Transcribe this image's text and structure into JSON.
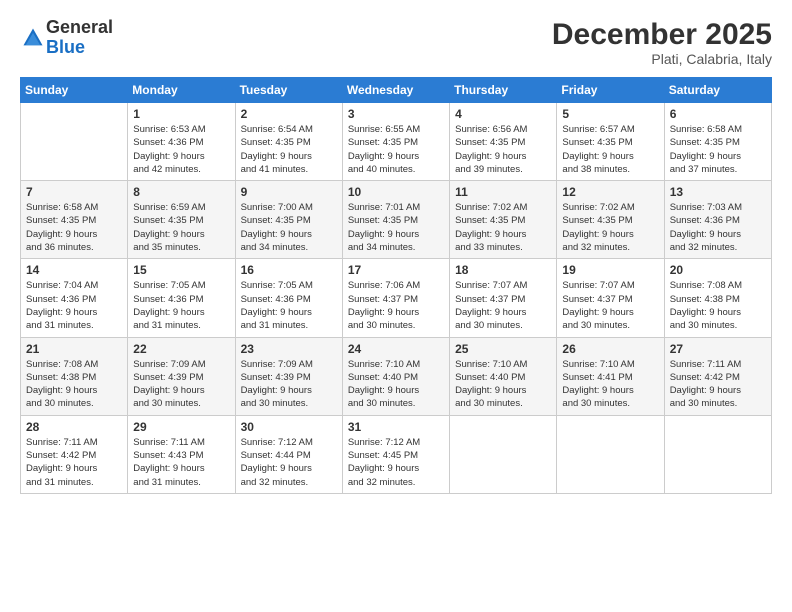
{
  "logo": {
    "general": "General",
    "blue": "Blue"
  },
  "header": {
    "month": "December 2025",
    "location": "Plati, Calabria, Italy"
  },
  "weekdays": [
    "Sunday",
    "Monday",
    "Tuesday",
    "Wednesday",
    "Thursday",
    "Friday",
    "Saturday"
  ],
  "weeks": [
    [
      {
        "day": "",
        "info": ""
      },
      {
        "day": "1",
        "info": "Sunrise: 6:53 AM\nSunset: 4:36 PM\nDaylight: 9 hours\nand 42 minutes."
      },
      {
        "day": "2",
        "info": "Sunrise: 6:54 AM\nSunset: 4:35 PM\nDaylight: 9 hours\nand 41 minutes."
      },
      {
        "day": "3",
        "info": "Sunrise: 6:55 AM\nSunset: 4:35 PM\nDaylight: 9 hours\nand 40 minutes."
      },
      {
        "day": "4",
        "info": "Sunrise: 6:56 AM\nSunset: 4:35 PM\nDaylight: 9 hours\nand 39 minutes."
      },
      {
        "day": "5",
        "info": "Sunrise: 6:57 AM\nSunset: 4:35 PM\nDaylight: 9 hours\nand 38 minutes."
      },
      {
        "day": "6",
        "info": "Sunrise: 6:58 AM\nSunset: 4:35 PM\nDaylight: 9 hours\nand 37 minutes."
      }
    ],
    [
      {
        "day": "7",
        "info": "Sunrise: 6:58 AM\nSunset: 4:35 PM\nDaylight: 9 hours\nand 36 minutes."
      },
      {
        "day": "8",
        "info": "Sunrise: 6:59 AM\nSunset: 4:35 PM\nDaylight: 9 hours\nand 35 minutes."
      },
      {
        "day": "9",
        "info": "Sunrise: 7:00 AM\nSunset: 4:35 PM\nDaylight: 9 hours\nand 34 minutes."
      },
      {
        "day": "10",
        "info": "Sunrise: 7:01 AM\nSunset: 4:35 PM\nDaylight: 9 hours\nand 34 minutes."
      },
      {
        "day": "11",
        "info": "Sunrise: 7:02 AM\nSunset: 4:35 PM\nDaylight: 9 hours\nand 33 minutes."
      },
      {
        "day": "12",
        "info": "Sunrise: 7:02 AM\nSunset: 4:35 PM\nDaylight: 9 hours\nand 32 minutes."
      },
      {
        "day": "13",
        "info": "Sunrise: 7:03 AM\nSunset: 4:36 PM\nDaylight: 9 hours\nand 32 minutes."
      }
    ],
    [
      {
        "day": "14",
        "info": "Sunrise: 7:04 AM\nSunset: 4:36 PM\nDaylight: 9 hours\nand 31 minutes."
      },
      {
        "day": "15",
        "info": "Sunrise: 7:05 AM\nSunset: 4:36 PM\nDaylight: 9 hours\nand 31 minutes."
      },
      {
        "day": "16",
        "info": "Sunrise: 7:05 AM\nSunset: 4:36 PM\nDaylight: 9 hours\nand 31 minutes."
      },
      {
        "day": "17",
        "info": "Sunrise: 7:06 AM\nSunset: 4:37 PM\nDaylight: 9 hours\nand 30 minutes."
      },
      {
        "day": "18",
        "info": "Sunrise: 7:07 AM\nSunset: 4:37 PM\nDaylight: 9 hours\nand 30 minutes."
      },
      {
        "day": "19",
        "info": "Sunrise: 7:07 AM\nSunset: 4:37 PM\nDaylight: 9 hours\nand 30 minutes."
      },
      {
        "day": "20",
        "info": "Sunrise: 7:08 AM\nSunset: 4:38 PM\nDaylight: 9 hours\nand 30 minutes."
      }
    ],
    [
      {
        "day": "21",
        "info": "Sunrise: 7:08 AM\nSunset: 4:38 PM\nDaylight: 9 hours\nand 30 minutes."
      },
      {
        "day": "22",
        "info": "Sunrise: 7:09 AM\nSunset: 4:39 PM\nDaylight: 9 hours\nand 30 minutes."
      },
      {
        "day": "23",
        "info": "Sunrise: 7:09 AM\nSunset: 4:39 PM\nDaylight: 9 hours\nand 30 minutes."
      },
      {
        "day": "24",
        "info": "Sunrise: 7:10 AM\nSunset: 4:40 PM\nDaylight: 9 hours\nand 30 minutes."
      },
      {
        "day": "25",
        "info": "Sunrise: 7:10 AM\nSunset: 4:40 PM\nDaylight: 9 hours\nand 30 minutes."
      },
      {
        "day": "26",
        "info": "Sunrise: 7:10 AM\nSunset: 4:41 PM\nDaylight: 9 hours\nand 30 minutes."
      },
      {
        "day": "27",
        "info": "Sunrise: 7:11 AM\nSunset: 4:42 PM\nDaylight: 9 hours\nand 30 minutes."
      }
    ],
    [
      {
        "day": "28",
        "info": "Sunrise: 7:11 AM\nSunset: 4:42 PM\nDaylight: 9 hours\nand 31 minutes."
      },
      {
        "day": "29",
        "info": "Sunrise: 7:11 AM\nSunset: 4:43 PM\nDaylight: 9 hours\nand 31 minutes."
      },
      {
        "day": "30",
        "info": "Sunrise: 7:12 AM\nSunset: 4:44 PM\nDaylight: 9 hours\nand 32 minutes."
      },
      {
        "day": "31",
        "info": "Sunrise: 7:12 AM\nSunset: 4:45 PM\nDaylight: 9 hours\nand 32 minutes."
      },
      {
        "day": "",
        "info": ""
      },
      {
        "day": "",
        "info": ""
      },
      {
        "day": "",
        "info": ""
      }
    ]
  ]
}
